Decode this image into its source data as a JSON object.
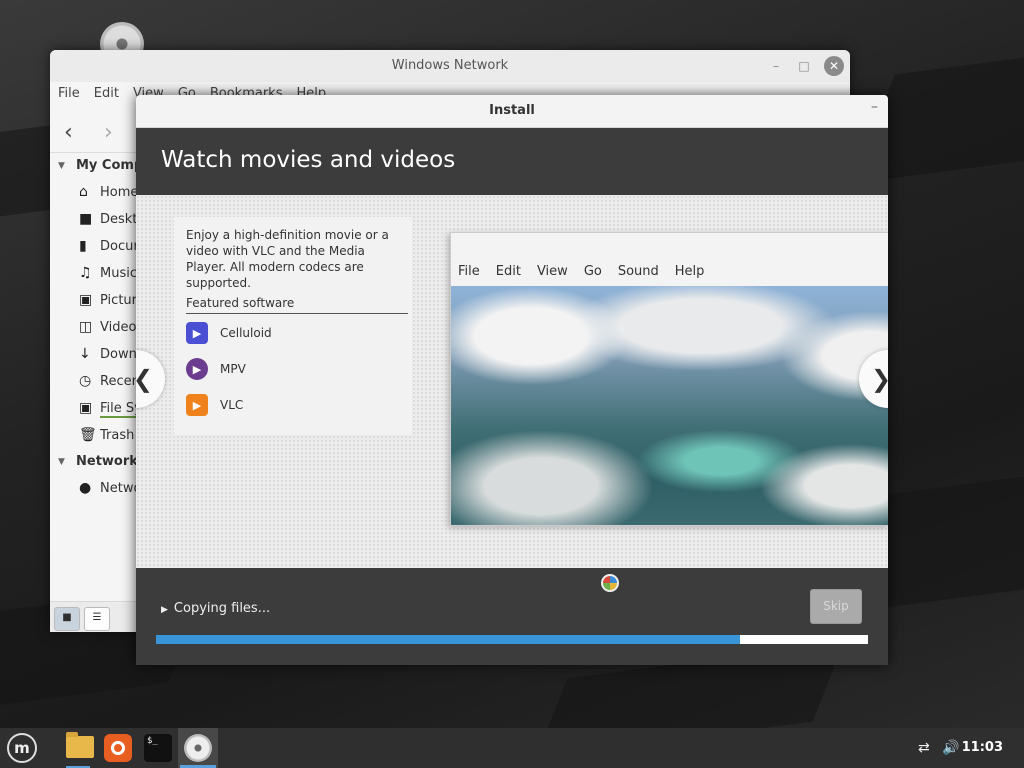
{
  "nemo": {
    "title": "Windows Network",
    "menu": [
      "File",
      "Edit",
      "View",
      "Go",
      "Bookmarks",
      "Help"
    ],
    "sections": [
      {
        "heading": "My Computer",
        "items": [
          {
            "label": "Home",
            "icon": "home-icon"
          },
          {
            "label": "Desktop",
            "icon": "desktop-icon"
          },
          {
            "label": "Documents",
            "icon": "documents-icon"
          },
          {
            "label": "Music",
            "icon": "music-icon"
          },
          {
            "label": "Pictures",
            "icon": "pictures-icon"
          },
          {
            "label": "Videos",
            "icon": "videos-icon"
          },
          {
            "label": "Downloads",
            "icon": "downloads-icon"
          },
          {
            "label": "Recent",
            "icon": "recent-icon"
          },
          {
            "label": "File System",
            "icon": "file-system-icon"
          },
          {
            "label": "Trash",
            "icon": "trash-icon"
          }
        ]
      },
      {
        "heading": "Network",
        "items": [
          {
            "label": "Network",
            "icon": "network-icon"
          }
        ]
      }
    ]
  },
  "installer": {
    "title": "Install",
    "heading": "Watch movies and videos",
    "description": "Enjoy a high-definition movie or a video with VLC and the Media Player. All modern codecs are supported.",
    "featured_label": "Featured software",
    "apps": [
      {
        "label": "Celluloid",
        "icon": "celluloid-icon",
        "color": "#4a4fd4"
      },
      {
        "label": "MPV",
        "icon": "mpv-icon",
        "color": "#6c3d8e"
      },
      {
        "label": "VLC",
        "icon": "vlc-icon",
        "color": "#f0821e"
      }
    ],
    "screenshot_menu": [
      "File",
      "Edit",
      "View",
      "Go",
      "Sound",
      "Help"
    ],
    "status": "Copying files...",
    "skip_label": "Skip",
    "progress": 0.82
  },
  "taskbar": {
    "clock": "11:03",
    "apps": [
      "menu-icon",
      "files-icon",
      "firefox-icon",
      "terminal-icon",
      "install-disc-icon"
    ]
  },
  "colors": {
    "accent": "#3a94d8",
    "installer_dark": "#3c3c3c",
    "taskbar": "#2f2f2f"
  }
}
